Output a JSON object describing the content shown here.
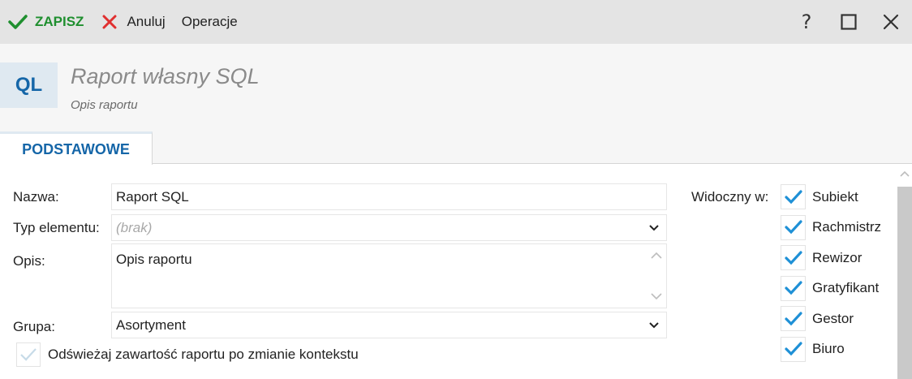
{
  "toolbar": {
    "save_label": "ZAPISZ",
    "cancel_label": "Anuluj",
    "operations_label": "Operacje",
    "help_label": "?"
  },
  "header": {
    "badge": "QL",
    "title": "Raport własny SQL",
    "description": "Opis raportu"
  },
  "tabs": [
    {
      "label": "PODSTAWOWE",
      "active": true
    }
  ],
  "form": {
    "name_label": "Nazwa:",
    "name_value": "Raport SQL",
    "type_label": "Typ elementu:",
    "type_value": "(brak)",
    "desc_label": "Opis:",
    "desc_value": "Opis raportu",
    "group_label": "Grupa:",
    "group_value": "Asortyment",
    "refresh_label": "Odświeżaj zawartość raportu po zmianie kontekstu"
  },
  "visibility": {
    "label": "Widoczny w:",
    "items": [
      {
        "label": "Subiekt",
        "checked": true
      },
      {
        "label": "Rachmistrz",
        "checked": true
      },
      {
        "label": "Rewizor",
        "checked": true
      },
      {
        "label": "Gratyfikant",
        "checked": true
      },
      {
        "label": "Gestor",
        "checked": true
      },
      {
        "label": "Biuro",
        "checked": true
      }
    ]
  },
  "colors": {
    "save_green": "#1f8f2f",
    "cancel_red": "#e03030",
    "accent_blue": "#1566a8",
    "check_blue": "#1e90d6"
  },
  "icons": {
    "save": "checkmark-icon",
    "cancel": "x-icon",
    "help": "question-icon",
    "maximize": "square-icon",
    "close": "close-icon"
  }
}
